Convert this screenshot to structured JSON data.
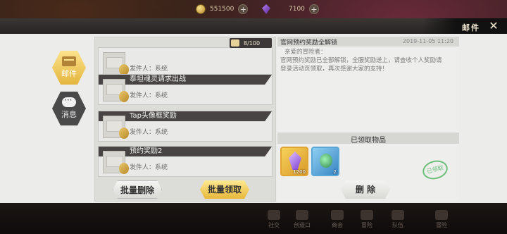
{
  "resources": {
    "gold": "551500",
    "gems": "7100"
  },
  "window": {
    "title": "邮件",
    "close": "✕"
  },
  "tabs": [
    {
      "label": "邮件"
    },
    {
      "label": "消息"
    }
  ],
  "mail_counter": "8/100",
  "mail_list": [
    {
      "subject": "",
      "sender": "发件人：系统"
    },
    {
      "subject": "泰坦魂灵请求出战",
      "sender": "发件人：系统"
    },
    {
      "subject": "Tap头像框奖励",
      "sender": "发件人：系统"
    },
    {
      "subject": "预约奖励2",
      "sender": "发件人：系统"
    }
  ],
  "detail": {
    "title": "官网预约奖励全解锁",
    "time": "2019-11-05 11:20",
    "greeting": "亲爱的冒险者：",
    "body": "官网预约奖励已全部解锁，全服奖励送上，请查收个人奖励请登录活动页领取，再次感谢大家的支持！",
    "received_label": "已领取物品",
    "items": [
      {
        "icon": "purple-crystal-icon",
        "count": "1200"
      },
      {
        "icon": "green-potion-icon",
        "count": "2"
      }
    ],
    "stamp": "已领取"
  },
  "buttons": {
    "batch_delete": "批量删除",
    "batch_claim": "批量领取",
    "delete": "删 除"
  },
  "dock": [
    "社交",
    "创造口",
    "商会",
    "冒险",
    "队伍",
    "冒险"
  ]
}
